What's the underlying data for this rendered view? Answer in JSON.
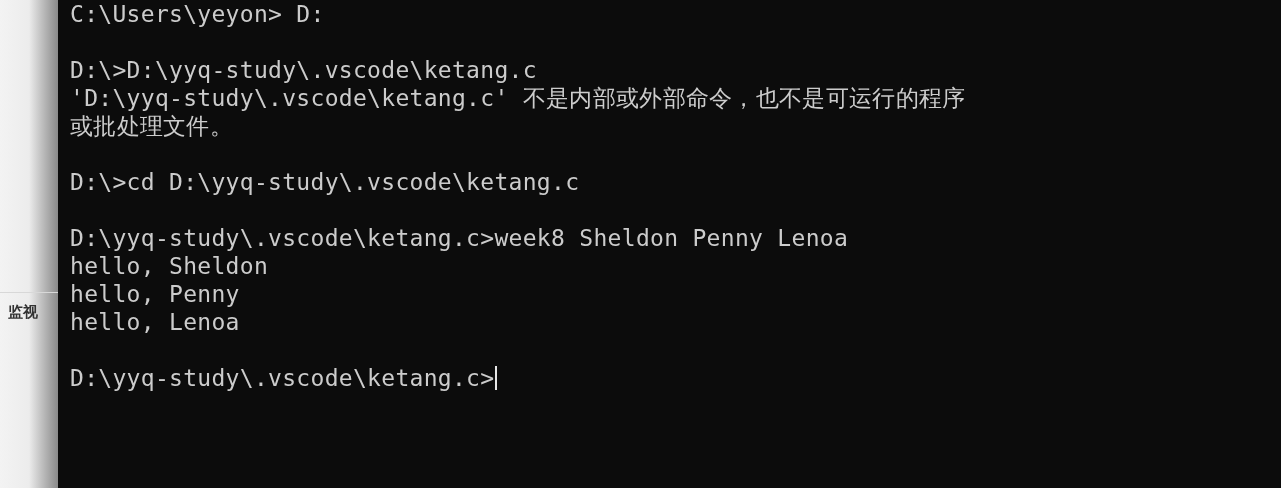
{
  "side_panel": {
    "label": "监视"
  },
  "terminal": {
    "lines": [
      {
        "kind": "text",
        "text": "C:\\Users\\yeyon> D:"
      },
      {
        "kind": "blank"
      },
      {
        "kind": "text",
        "text": "D:\\>D:\\yyq-study\\.vscode\\ketang.c"
      },
      {
        "kind": "text",
        "text": "'D:\\yyq-study\\.vscode\\ketang.c' 不是内部或外部命令，也不是可运行的程序"
      },
      {
        "kind": "text",
        "text": "或批处理文件。"
      },
      {
        "kind": "blank"
      },
      {
        "kind": "text",
        "text": "D:\\>cd D:\\yyq-study\\.vscode\\ketang.c"
      },
      {
        "kind": "blank"
      },
      {
        "kind": "text",
        "text": "D:\\yyq-study\\.vscode\\ketang.c>week8 Sheldon Penny Lenoa"
      },
      {
        "kind": "text",
        "text": "hello, Sheldon"
      },
      {
        "kind": "text",
        "text": "hello, Penny"
      },
      {
        "kind": "text",
        "text": "hello, Lenoa"
      },
      {
        "kind": "blank"
      },
      {
        "kind": "text",
        "text": "D:\\yyq-study\\.vscode\\ketang.c>",
        "cursor": true
      }
    ]
  }
}
